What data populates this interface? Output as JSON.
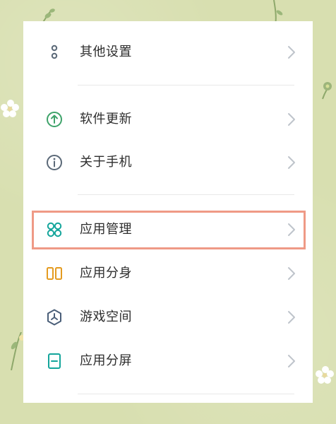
{
  "colors": {
    "wallpaper": "#d8dfb0",
    "card": "#ffffff",
    "text": "#2d2d2d",
    "chevron": "#bfc4cb",
    "divider": "#e8e8e8",
    "highlight": "#ef9a86"
  },
  "settings": {
    "items": [
      {
        "label": "其他设置",
        "icon": "more-settings-icon"
      },
      {
        "label": "软件更新",
        "icon": "software-update-icon"
      },
      {
        "label": "关于手机",
        "icon": "about-phone-icon"
      },
      {
        "label": "应用管理",
        "icon": "app-management-icon",
        "highlighted": true
      },
      {
        "label": "应用分身",
        "icon": "app-clone-icon"
      },
      {
        "label": "游戏空间",
        "icon": "game-space-icon"
      },
      {
        "label": "应用分屏",
        "icon": "split-screen-icon"
      }
    ]
  }
}
